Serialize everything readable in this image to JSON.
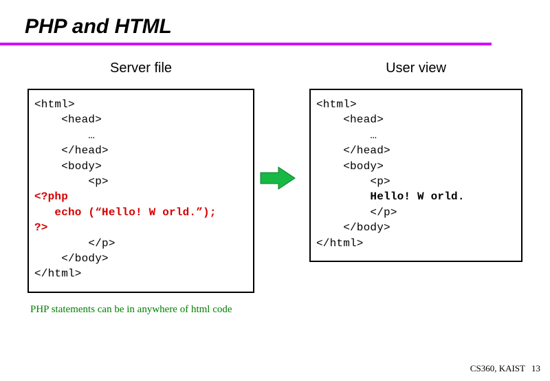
{
  "title": "PHP and HTML",
  "left_heading": "Server file",
  "right_heading": "User view",
  "server_code": {
    "l1": "<html>",
    "l2": "    <head>",
    "l3": "        …",
    "l4": "    </head>",
    "l5": "    <body>",
    "l6": "        <p>",
    "php1": "<?php",
    "php2": "   echo (“Hello! W orld.”);",
    "php3": "?>",
    "l7": "        </p>",
    "l8": "    </body>",
    "l9": "</html>"
  },
  "user_code": {
    "l1": "<html>",
    "l2": "    <head>",
    "l3": "        …",
    "l4": "    </head>",
    "l5": "    <body>",
    "l6": "        <p>",
    "out": "        Hello! W orld.",
    "l7": "        </p>",
    "l8": "    </body>",
    "l9": "</html>"
  },
  "note": "PHP statements can be in anywhere of html code",
  "footer_course": "CS360, KAIST",
  "footer_page": "13"
}
